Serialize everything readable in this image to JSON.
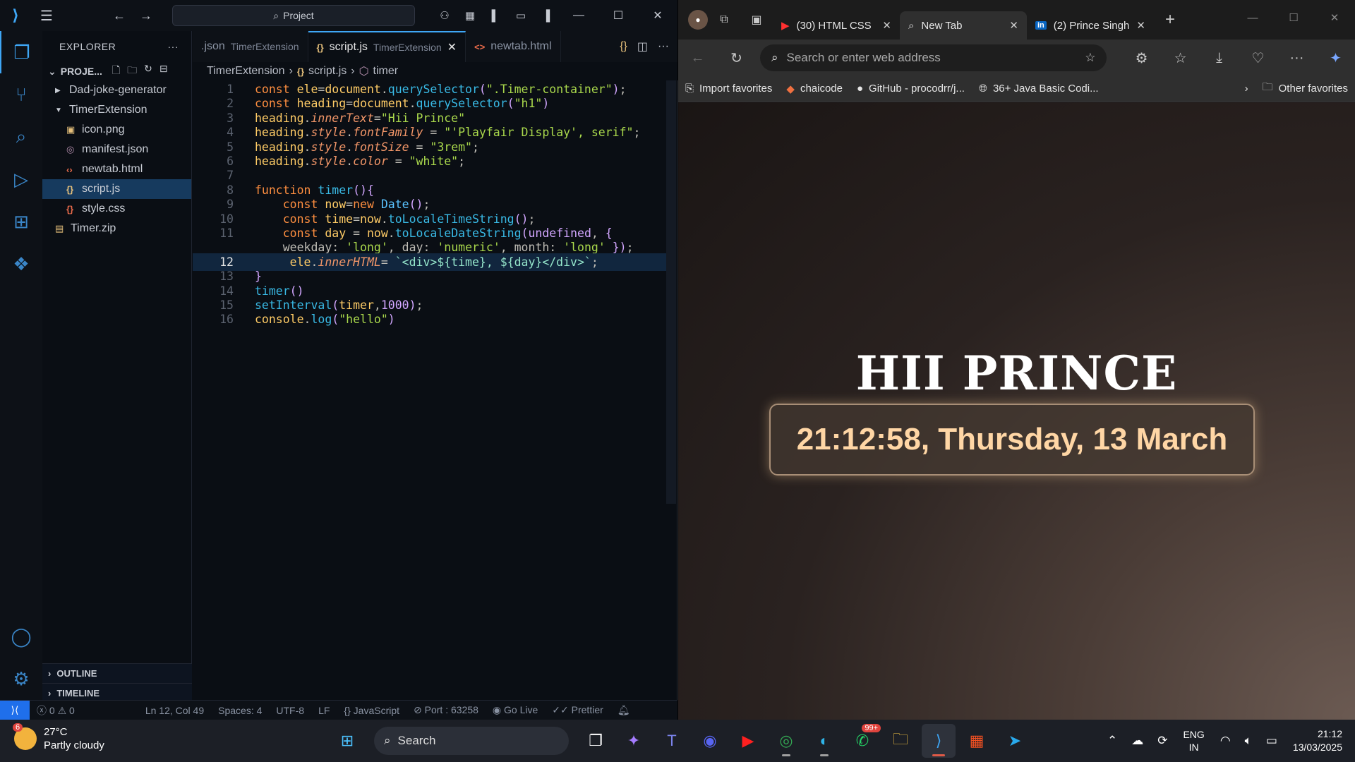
{
  "vscode": {
    "search_label": "Project",
    "explorer_title": "EXPLORER",
    "project_name": "PROJE...",
    "tree": [
      {
        "label": "Dad-joke-generator",
        "type": "folder",
        "expanded": false,
        "depth": 0
      },
      {
        "label": "TimerExtension",
        "type": "folder",
        "expanded": true,
        "depth": 0
      },
      {
        "label": "icon.png",
        "type": "image",
        "depth": 1
      },
      {
        "label": "manifest.json",
        "type": "json",
        "depth": 1
      },
      {
        "label": "newtab.html",
        "type": "html",
        "depth": 1
      },
      {
        "label": "script.js",
        "type": "js",
        "depth": 1,
        "selected": true
      },
      {
        "label": "style.css",
        "type": "css",
        "depth": 1
      },
      {
        "label": "Timer.zip",
        "type": "zip",
        "depth": 0
      }
    ],
    "outline_label": "OUTLINE",
    "timeline_label": "TIMELINE",
    "tabs": [
      {
        "label": ".json",
        "sub": "TimerExtension",
        "active": false
      },
      {
        "label": "script.js",
        "sub": "TimerExtension",
        "active": true
      },
      {
        "label": "newtab.html",
        "sub": "",
        "active": false
      }
    ],
    "breadcrumb": [
      "TimerExtension",
      "script.js",
      "timer"
    ],
    "current_line": 12,
    "code_lines": [
      "const ele=document.querySelector(\".Timer-container\");",
      "const heading=document.querySelector(\"h1\")",
      "heading.innerText=\"Hii Prince\"",
      "heading.style.fontFamily = \"'Playfair Display', serif\";",
      "heading.style.fontSize = \"3rem\";",
      "heading.style.color = \"white\";",
      "",
      "function timer(){",
      "    const now=new Date();",
      "    const time=now.toLocaleTimeString();",
      "    const day = now.toLocaleDateString(undefined, {",
      "    weekday: 'long', day: 'numeric', month: 'long' });",
      "     ele.innerHTML= `<div>${time}, ${day}</div>`;",
      "}",
      "timer()",
      "setInterval(timer,1000);",
      "console.log(\"hello\")"
    ],
    "line_numbers": [
      "1",
      "2",
      "3",
      "4",
      "5",
      "6",
      "7",
      "8",
      "9",
      "10",
      "11",
      "",
      "12",
      "13",
      "14",
      "15",
      "16"
    ],
    "status": {
      "errors": "0",
      "warnings": "0",
      "position": "Ln 12, Col 49",
      "spaces": "Spaces: 4",
      "encoding": "UTF-8",
      "eol": "LF",
      "language": "JavaScript",
      "port": "Port : 63258",
      "golive": "Go Live",
      "prettier": "Prettier"
    }
  },
  "edge": {
    "tabs": [
      {
        "label": "(30) HTML CSS",
        "icon": "youtube-icon",
        "active": false
      },
      {
        "label": "New Tab",
        "icon": "search-icon",
        "active": true
      },
      {
        "label": "(2) Prince Singh",
        "icon": "linkedin-icon",
        "active": false
      }
    ],
    "address_placeholder": "Search or enter web address",
    "favorites": [
      "Import favorites",
      "chaicode",
      "GitHub - procodrr/j...",
      "36+ Java Basic Codi..."
    ],
    "other_favorites": "Other favorites",
    "page": {
      "heading": "HII PRINCE",
      "timer_text": "21:12:58, Thursday, 13 March"
    }
  },
  "taskbar": {
    "weather_temp": "27°C",
    "weather_desc": "Partly cloudy",
    "weather_badge": "6",
    "search_label": "Search",
    "whatsapp_badge": "99+",
    "lang_1": "ENG",
    "lang_2": "IN",
    "time": "21:12",
    "date": "13/03/2025"
  }
}
